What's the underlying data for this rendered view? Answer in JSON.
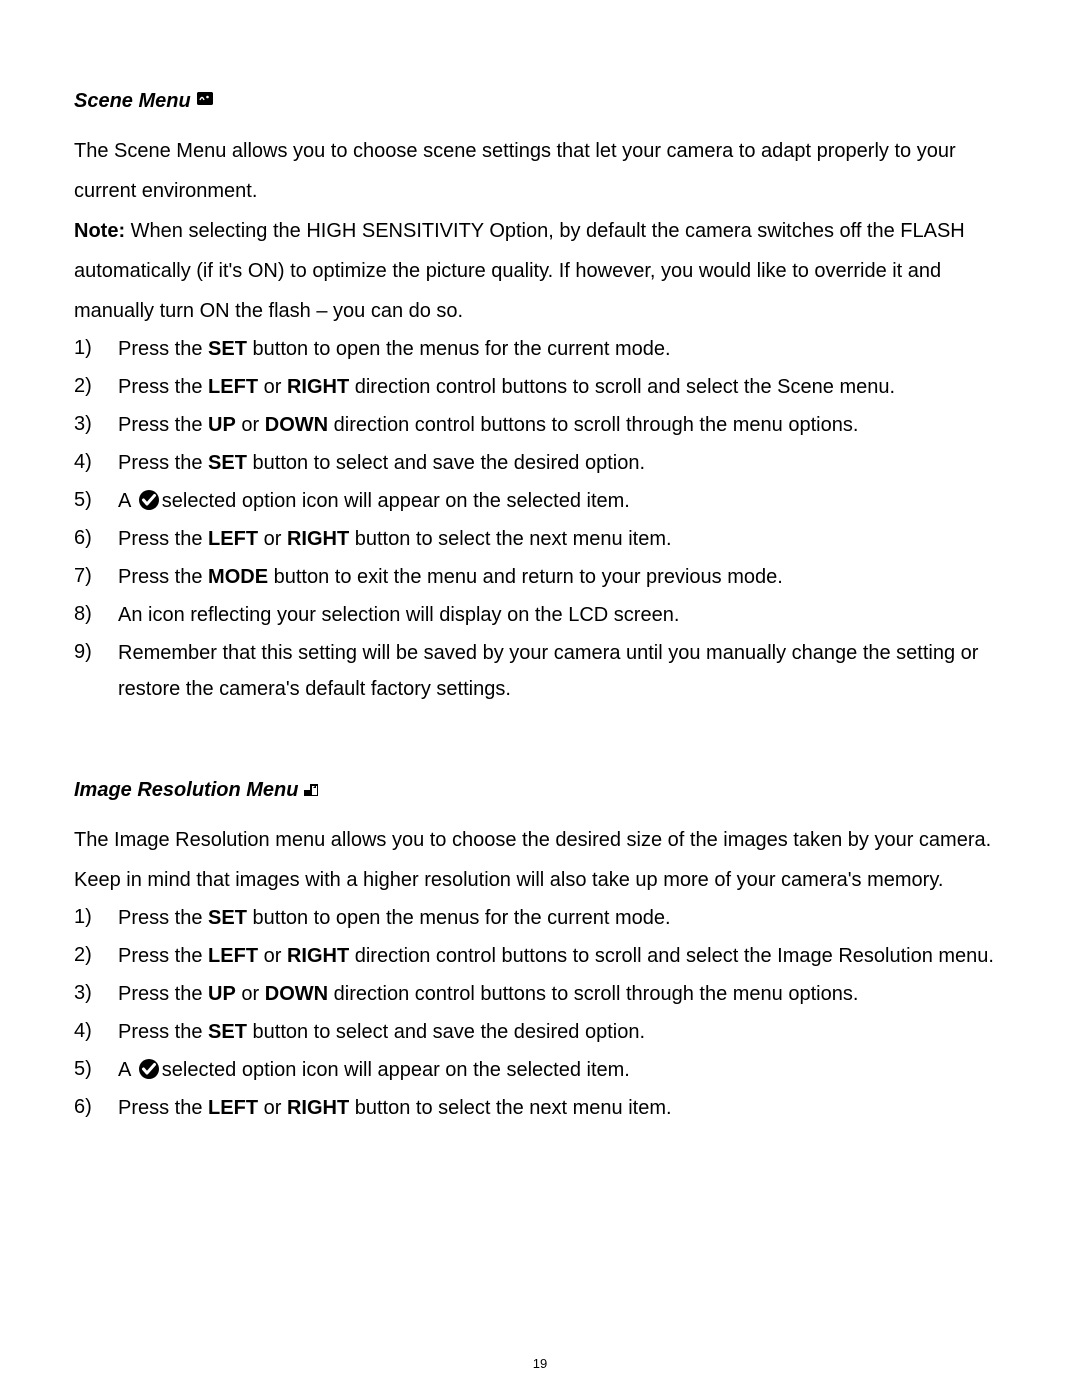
{
  "page_number": "19",
  "scene_menu": {
    "title": "Scene Menu",
    "intro": "The Scene Menu allows you to choose scene settings that let your camera to adapt properly to your current environment.",
    "note_label": "Note:",
    "note_body": "   When selecting the HIGH SENSITIVITY Option, by default the camera switches off the FLASH automatically (if it's ON) to optimize the picture quality. If however, you would like to override it and manually turn ON the flash – you can do so.",
    "steps": {
      "s1_pre": "Press the ",
      "s1_b": "SET",
      "s1_post": " button to open the menus for the current mode.",
      "s2_pre": "Press the ",
      "s2_b1": "LEFT",
      "s2_mid": " or ",
      "s2_b2": "RIGHT",
      "s2_post": " direction control buttons to scroll and select the Scene menu.",
      "s3_pre": "Press the ",
      "s3_b1": "UP",
      "s3_mid": " or ",
      "s3_b2": "DOWN",
      "s3_post": " direction control buttons to scroll through the menu options.",
      "s4_pre": "Press the ",
      "s4_b": "SET",
      "s4_post": " button to select and save the desired option.",
      "s5_pre": "A  ",
      "s5_post": "selected option icon will appear on the selected item.",
      "s6_pre": "Press the ",
      "s6_b1": "LEFT",
      "s6_mid": " or ",
      "s6_b2": "RIGHT",
      "s6_post": " button to select the next menu item.",
      "s7_pre": "Press the ",
      "s7_b": "MODE",
      "s7_post": " button to exit the menu and return to your previous mode.",
      "s8": "An icon reflecting your selection will display on the LCD screen.",
      "s9": "Remember that this setting will be saved by your camera until you manually change the setting or restore the camera's default factory settings."
    },
    "nums": {
      "n1": "1)",
      "n2": "2)",
      "n3": "3)",
      "n4": "4)",
      "n5": "5)",
      "n6": "6)",
      "n7": "7)",
      "n8": "8)",
      "n9": "9)"
    }
  },
  "image_res": {
    "title": "Image Resolution Menu",
    "intro": "The Image Resolution menu allows you to choose the desired size of the images taken by your camera. Keep in mind that images with a higher resolution will also take up more of your camera's memory.",
    "steps": {
      "s1_pre": "Press the ",
      "s1_b": "SET",
      "s1_post": " button to open the menus for the current mode.",
      "s2_pre": "Press the ",
      "s2_b1": "LEFT",
      "s2_mid": " or ",
      "s2_b2": "RIGHT",
      "s2_post": " direction control buttons to scroll and select the Image Resolution menu.",
      "s3_pre": "Press the ",
      "s3_b1": "UP",
      "s3_mid": " or ",
      "s3_b2": "DOWN",
      "s3_post": " direction control buttons to scroll through the menu options.",
      "s4_pre": "Press the ",
      "s4_b": "SET",
      "s4_post": " button to select and save the desired option.",
      "s5_pre": "A  ",
      "s5_post": "selected option icon will appear on the selected item.",
      "s6_pre": "Press the ",
      "s6_b1": "LEFT",
      "s6_mid": " or ",
      "s6_b2": "RIGHT",
      "s6_post": " button to select the next menu item."
    },
    "nums": {
      "n1": "1)",
      "n2": "2)",
      "n3": "3)",
      "n4": "4)",
      "n5": "5)",
      "n6": "6)"
    }
  }
}
